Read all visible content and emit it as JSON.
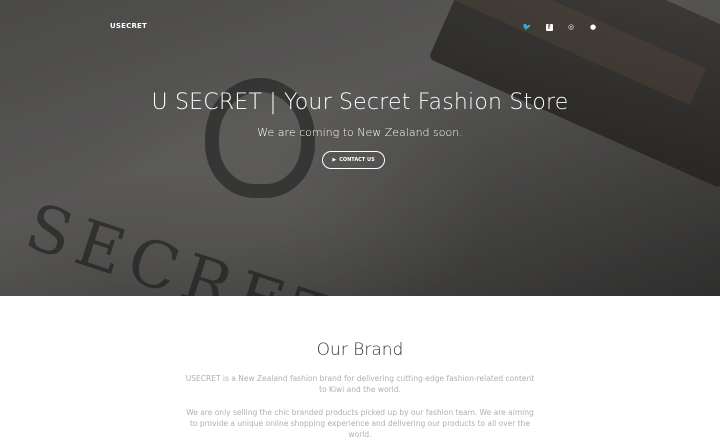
{
  "nav": {
    "brand": "USECRET",
    "social": [
      {
        "icon": "twitter-icon",
        "glyph": "🐦"
      },
      {
        "icon": "facebook-icon",
        "glyph": "f"
      },
      {
        "icon": "instagram-icon",
        "glyph": "◎"
      },
      {
        "icon": "github-icon",
        "glyph": "●"
      }
    ]
  },
  "hero": {
    "title": "U SECRET | Your Secret Fashion Store",
    "subtitle": "We are coming to New Zealand soon.",
    "cta_label": "CONTACT US",
    "cta_icon": "play-icon"
  },
  "brand_section": {
    "title": "Our Brand",
    "paragraph1": "USECRET is a New Zealand fashion brand for delivering cutting-edge fashion-related content to Kiwi and the world.",
    "paragraph2": "We are only selling the chic branded products picked up by our fashion team. We are aiming to provide a unique online shopping experience and delivering our products to all over the world."
  },
  "colors": {
    "text_muted": "#b0b0b0",
    "heading": "#333333",
    "hero_text": "#ffffff"
  }
}
